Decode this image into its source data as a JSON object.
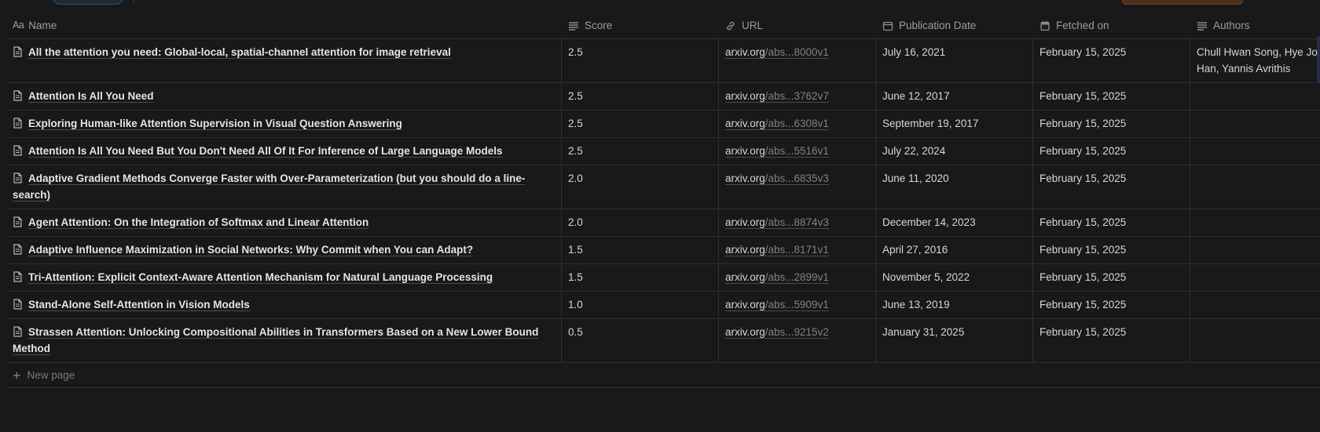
{
  "columns": {
    "name": "Name",
    "name_icon": "Aa",
    "score": "Score",
    "url": "URL",
    "publication_date": "Publication Date",
    "fetched_on": "Fetched on",
    "authors": "Authors"
  },
  "rows": [
    {
      "title": "All the attention you need: Global-local, spatial-channel attention for image retrieval",
      "score": "2.5",
      "url_domain": "arxiv.org",
      "url_rest": "/abs...8000v1",
      "pub": "July 16, 2021",
      "fetched": "February 15, 2025",
      "authors": "Chull Hwan Song, Hye Jo Han, Yannis Avrithis"
    },
    {
      "title": "Attention Is All You Need",
      "score": "2.5",
      "url_domain": "arxiv.org",
      "url_rest": "/abs...3762v7",
      "pub": "June 12, 2017",
      "fetched": "February 15, 2025",
      "authors": ""
    },
    {
      "title": "Exploring Human-like Attention Supervision in Visual Question Answering",
      "score": "2.5",
      "url_domain": "arxiv.org",
      "url_rest": "/abs...6308v1",
      "pub": "September 19, 2017",
      "fetched": "February 15, 2025",
      "authors": ""
    },
    {
      "title": "Attention Is All You Need But You Don't Need All Of It For Inference of Large Language Models",
      "score": "2.5",
      "url_domain": "arxiv.org",
      "url_rest": "/abs...5516v1",
      "pub": "July 22, 2024",
      "fetched": "February 15, 2025",
      "authors": ""
    },
    {
      "title": "Adaptive Gradient Methods Converge Faster with Over-Parameterization (but you should do a line-search)",
      "score": "2.0",
      "url_domain": "arxiv.org",
      "url_rest": "/abs...6835v3",
      "pub": "June 11, 2020",
      "fetched": "February 15, 2025",
      "authors": ""
    },
    {
      "title": "Agent Attention: On the Integration of Softmax and Linear Attention",
      "score": "2.0",
      "url_domain": "arxiv.org",
      "url_rest": "/abs...8874v3",
      "pub": "December 14, 2023",
      "fetched": "February 15, 2025",
      "authors": ""
    },
    {
      "title": "Adaptive Influence Maximization in Social Networks: Why Commit when You can Adapt?",
      "score": "1.5",
      "url_domain": "arxiv.org",
      "url_rest": "/abs...8171v1",
      "pub": "April 27, 2016",
      "fetched": "February 15, 2025",
      "authors": ""
    },
    {
      "title": "Tri-Attention: Explicit Context-Aware Attention Mechanism for Natural Language Processing",
      "score": "1.5",
      "url_domain": "arxiv.org",
      "url_rest": "/abs...2899v1",
      "pub": "November 5, 2022",
      "fetched": "February 15, 2025",
      "authors": ""
    },
    {
      "title": "Stand-Alone Self-Attention in Vision Models",
      "score": "1.0",
      "url_domain": "arxiv.org",
      "url_rest": "/abs...5909v1",
      "pub": "June 13, 2019",
      "fetched": "February 15, 2025",
      "authors": ""
    },
    {
      "title": "Strassen Attention: Unlocking Compositional Abilities in Transformers Based on a New Lower Bound Method",
      "score": "0.5",
      "url_domain": "arxiv.org",
      "url_rest": "/abs...9215v2",
      "pub": "January 31, 2025",
      "fetched": "February 15, 2025",
      "authors": ""
    }
  ],
  "new_page_label": "New page"
}
